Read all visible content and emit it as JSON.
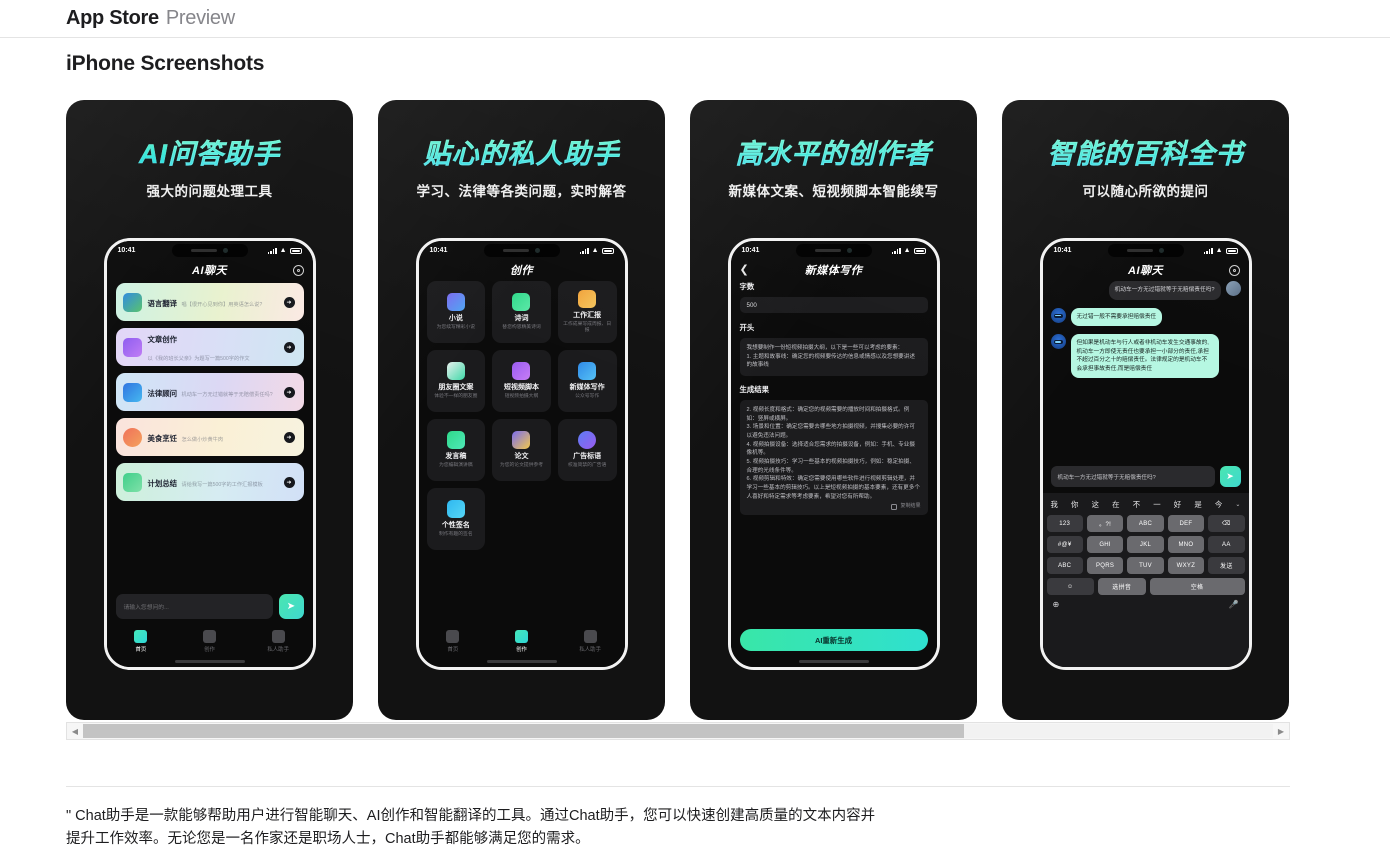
{
  "header": {
    "brand": "App Store",
    "preview": "Preview"
  },
  "section": {
    "title": "iPhone Screenshots"
  },
  "status": {
    "time": "10:41"
  },
  "shots": [
    {
      "title": "AI问答助手",
      "subtitle": "强大的问题处理工具",
      "app_title": "AI聊天",
      "list": [
        {
          "name": "语言翻译",
          "desc": "唱【很开心见到你】用英语怎么说?"
        },
        {
          "name": "文章创作",
          "desc": "以《我的班长父亲》为题写一篇500字的作文"
        },
        {
          "name": "法律顾问",
          "desc": "机动车一方无过错就等于无赔偿责任吗?"
        },
        {
          "name": "美食烹饪",
          "desc": "怎么做小炒黄牛肉"
        },
        {
          "name": "计划总结",
          "desc": "请给我写一篇500字的工作汇报模板"
        }
      ],
      "composer_placeholder": "请输入您想问的...",
      "tabs": [
        "首页",
        "创作",
        "私人助手"
      ]
    },
    {
      "title": "贴心的私人助手",
      "subtitle": "学习、法律等各类问题，实时解答",
      "app_title": "创作",
      "grid": [
        {
          "name": "小说",
          "desc": "为您续写精彩小说"
        },
        {
          "name": "诗词",
          "desc": "替您构思精美诗词"
        },
        {
          "name": "工作汇报",
          "desc": "工作成果写成周报、日报"
        },
        {
          "name": "朋友圈文案",
          "desc": "体验不一样的朋友圈"
        },
        {
          "name": "短视频脚本",
          "desc": "短视频拍摄大纲"
        },
        {
          "name": "新媒体写作",
          "desc": "公众号写作"
        },
        {
          "name": "发言稿",
          "desc": "为您编辑演讲稿"
        },
        {
          "name": "论文",
          "desc": "为您的论文提供参考"
        },
        {
          "name": "广告标语",
          "desc": "校准简禁的广告语"
        },
        {
          "name": "个性签名",
          "desc": "制作有趣的签名"
        }
      ],
      "tabs": [
        "首页",
        "创作",
        "私人助手"
      ]
    },
    {
      "title": "高水平的创作者",
      "subtitle": "新媒体文案、短视频脚本智能续写",
      "app_title": "新媒体写作",
      "label_count": "字数",
      "count_value": "500",
      "label_open": "开头",
      "open_text": "我想要制作一份短视频拍摄大纲，以下是一些可以考虑的要素：\n1. 主题和故事线：确定您的视频要传达的信息或情感以及您想要讲述的故事线",
      "label_result": "生成结果",
      "result_text": "2. 视频长度和格式：确定您的视频需要的播放时间和拍摄格式。例如：竖屏或横屏。\n3. 场景和位置：确定您需要去哪些地方拍摄视频，并搜集必要的许可以避免违法问题。\n4. 视频拍摄设备：选择适合您需求的拍摄设备，例如：手机、专业摄像机等。\n5. 视频拍摄技巧：学习一些基本的视频拍摄技巧，例如：稳定拍摄、合理的光线条件等。\n6. 视频剪辑和特效：确定您需要使用哪些软件进行视频剪辑处理，并学习一些基本的剪辑技巧。以上是短视频拍摄的基本要素，还有更多个人喜好和特定需求等考虑要素，希望对您有所帮助。",
      "copy_label": "复制结果",
      "regen_label": "AI重新生成"
    },
    {
      "title": "智能的百科全书",
      "subtitle": "可以随心所欲的提问",
      "app_title": "AI聊天",
      "messages": [
        {
          "from": "user",
          "text": "机动车一方无过错就等于无赔偿责任吗?"
        },
        {
          "from": "bot",
          "text": "无过错一般不需要承担赔偿责任"
        },
        {
          "from": "bot",
          "text": "但如果是机动车与行人或者非机动车发生交通事故的,机动车一方即使无责任也要承担一小部分的责任,承担不超过百分之十的赔偿责任。法律规定的是机动车不会承担事故责任,而是赔偿责任"
        }
      ],
      "input_value": "机动车一方无过错就等于无赔偿责任吗?",
      "keyboard": {
        "suggestions": [
          "我",
          "你",
          "这",
          "在",
          "不",
          "一",
          "好",
          "是",
          "今"
        ],
        "rows": [
          [
            "123",
            "。?!",
            "ABC",
            "DEF",
            "⌫"
          ],
          [
            "#@¥",
            "GHI",
            "JKL",
            "MNO",
            "AA"
          ],
          [
            "ABC",
            "PQRS",
            "TUV",
            "WXYZ",
            "发送"
          ],
          [
            "☺",
            "选拼音",
            "空格"
          ]
        ],
        "globe": "⊕",
        "mic": "🎤"
      }
    }
  ],
  "scrollbar": {
    "left_arrow": "◀",
    "right_arrow": "▶"
  },
  "description": "\" Chat助手是一款能够帮助用户进行智能聊天、AI创作和智能翻译的工具。通过Chat助手，您可以快速创建高质量的文本内容并提升工作效率。无论您是一名作家还是职场人士，Chat助手都能够满足您的需求。"
}
